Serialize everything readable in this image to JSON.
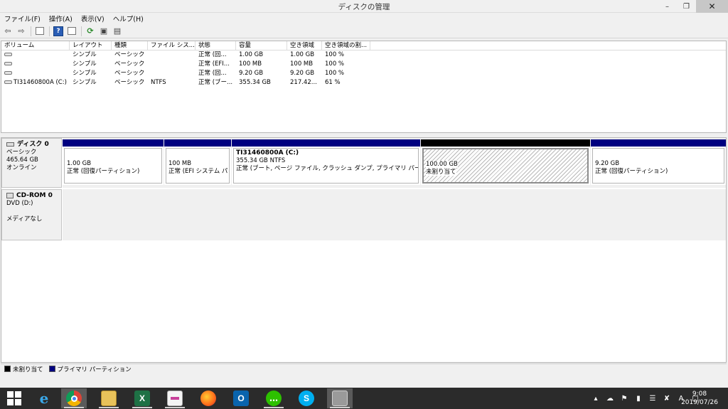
{
  "window": {
    "title": "ディスクの管理"
  },
  "menu": [
    "ファイル(F)",
    "操作(A)",
    "表示(V)",
    "ヘルプ(H)"
  ],
  "columns": [
    "ボリューム",
    "レイアウト",
    "種類",
    "ファイル シス...",
    "状態",
    "容量",
    "空き領域",
    "空き領域の割..."
  ],
  "volumes": [
    {
      "name": "",
      "layout": "シンプル",
      "type": "ベーシック",
      "fs": "",
      "status": "正常 (回...",
      "capacity": "1.00 GB",
      "free": "1.00 GB",
      "free_pct": "100 %"
    },
    {
      "name": "",
      "layout": "シンプル",
      "type": "ベーシック",
      "fs": "",
      "status": "正常 (EFI...",
      "capacity": "100 MB",
      "free": "100 MB",
      "free_pct": "100 %"
    },
    {
      "name": "",
      "layout": "シンプル",
      "type": "ベーシック",
      "fs": "",
      "status": "正常 (回...",
      "capacity": "9.20 GB",
      "free": "9.20 GB",
      "free_pct": "100 %"
    },
    {
      "name": "TI31460800A (C:)",
      "layout": "シンプル",
      "type": "ベーシック",
      "fs": "NTFS",
      "status": "正常 (ブー...",
      "capacity": "355.34 GB",
      "free": "217.42...",
      "free_pct": "61 %"
    }
  ],
  "disks": [
    {
      "name": "ディスク 0",
      "type": "ベーシック",
      "size": "465.64 GB",
      "state": "オンライン",
      "partitions": [
        {
          "size": "1.00 GB",
          "status": "正常 (回復パーティション)",
          "color": "#000080"
        },
        {
          "size": "100 MB",
          "status": "正常 (EFI システム パ",
          "color": "#000080"
        },
        {
          "name": "TI31460800A  (C:)",
          "size": "355.34 GB NTFS",
          "status": "正常 (ブート, ページ ファイル, クラッシュ ダンプ, プライマリ パーティション)",
          "color": "#000080"
        },
        {
          "size": "100.00 GB",
          "status": "未割り当て",
          "color": "#000000"
        },
        {
          "size": "9.20 GB",
          "status": "正常 (回復パーティション)",
          "color": "#000080"
        }
      ]
    },
    {
      "name": "CD-ROM 0",
      "type": "DVD (D:)",
      "media": "メディアなし"
    }
  ],
  "legend": [
    {
      "label": "未割り当て",
      "color": "#000000"
    },
    {
      "label": "プライマリ パーティション",
      "color": "#000080"
    }
  ],
  "tray": {
    "ime": "A"
  },
  "clock": {
    "time": "9:08",
    "date": "2019/07/26"
  }
}
